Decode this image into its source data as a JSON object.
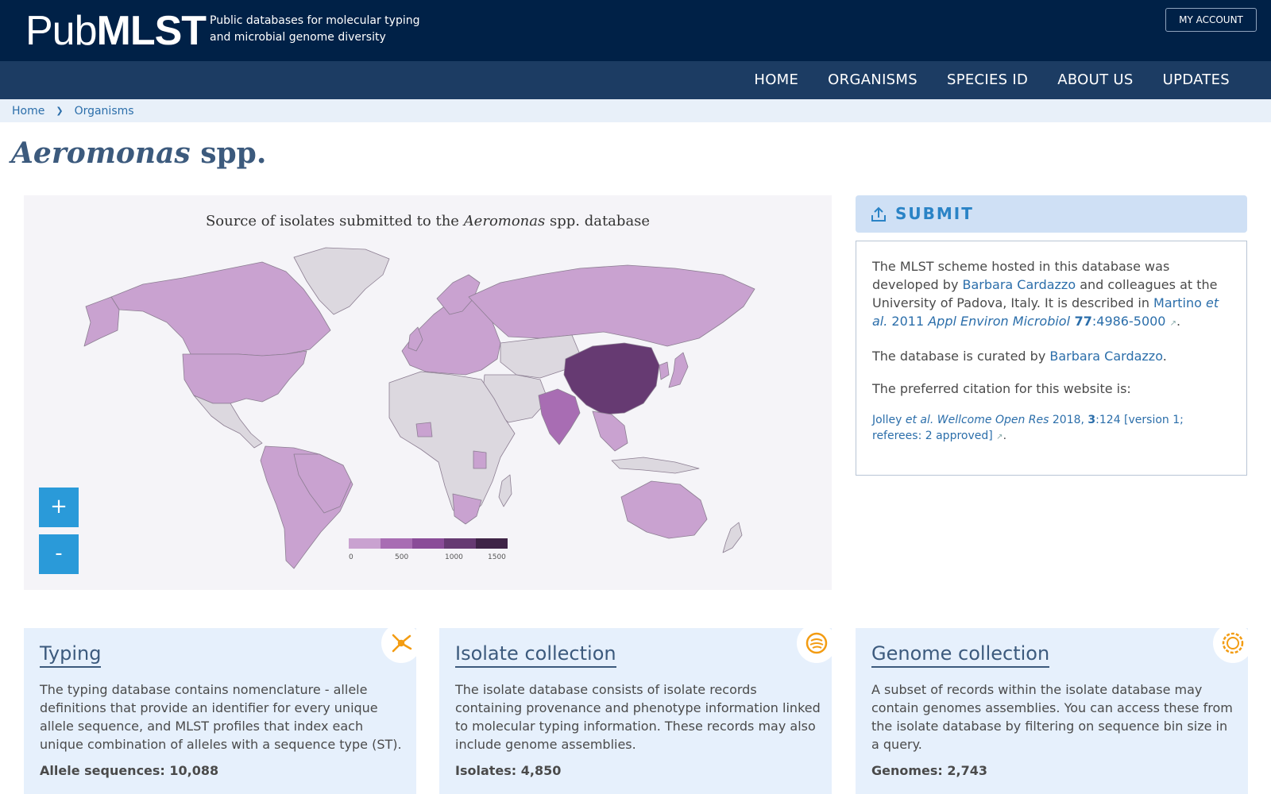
{
  "header": {
    "logo_light": "Pub",
    "logo_bold": "MLST",
    "tagline_line1": "Public databases for molecular typing",
    "tagline_line2": "and microbial genome diversity",
    "account_label": "MY ACCOUNT"
  },
  "nav": {
    "items": [
      "HOME",
      "ORGANISMS",
      "SPECIES ID",
      "ABOUT US",
      "UPDATES"
    ]
  },
  "breadcrumb": {
    "items": [
      "Home",
      "Organisms"
    ]
  },
  "page": {
    "title_italic": "Aeromonas",
    "title_rest": " spp."
  },
  "map": {
    "title_pre": "Source of isolates submitted to the ",
    "title_italic": "Aeromonas",
    "title_post": " spp. database",
    "zoom_in": "+",
    "zoom_out": "-",
    "legend_ticks": [
      "0",
      "500",
      "1000",
      "1500"
    ],
    "legend_colors": [
      "#c9a2d0",
      "#a86db3",
      "#8a4c98",
      "#663a72",
      "#3f2447"
    ],
    "colors": {
      "ocean": "#f5f4f8",
      "no_data": "#dcd8df",
      "low": "#c9a2d0",
      "mid": "#a86db3",
      "high": "#663a72",
      "border": "#8c7e92"
    }
  },
  "submit": {
    "label": "SUBMIT",
    "icon": "upload-icon"
  },
  "info": {
    "p1_a": "The MLST scheme hosted in this database was developed by ",
    "p1_link_author": "Barbara Cardazzo",
    "p1_b": " and colleagues at the University of Padova, Italy. It is described in ",
    "p1_ref_author": "Martino",
    "p1_ref_etal": " et al.",
    "p1_ref_year": " 2011 ",
    "p1_ref_journal": "Appl Environ Microbiol",
    "p1_ref_vol": " 77",
    "p1_ref_pages": ":4986-5000",
    "p1_end": ".",
    "p2_a": "The database is curated by ",
    "p2_link": "Barbara Cardazzo",
    "p2_end": ".",
    "p3": "The preferred citation for this website is:",
    "cite_author": "Jolley",
    "cite_etal": " et al.",
    "cite_journal": " Wellcome Open Res",
    "cite_year": " 2018, ",
    "cite_vol": "3",
    "cite_rest": ":124 [version 1; referees: 2 approved]",
    "cite_end": "."
  },
  "cards": [
    {
      "title": "Typing",
      "text": "The typing database contains nomenclature - allele definitions that provide an identifier for every unique allele sequence, and MLST profiles that index each unique combination of alleles with a sequence type (ST).",
      "count": "Allele sequences: 10,088",
      "icon": "network-icon"
    },
    {
      "title": "Isolate collection",
      "text": "The isolate database consists of isolate records containing provenance and phenotype information linked to molecular typing information. These records may also include genome assemblies.",
      "count": "Isolates: 4,850",
      "icon": "petri-dish-icon"
    },
    {
      "title": "Genome collection",
      "text": "A subset of records within the isolate database may contain genomes assemblies. You can access these from the isolate database by filtering on sequence bin size in a query.",
      "count": "Genomes: 2,743",
      "icon": "genome-ring-icon"
    }
  ]
}
